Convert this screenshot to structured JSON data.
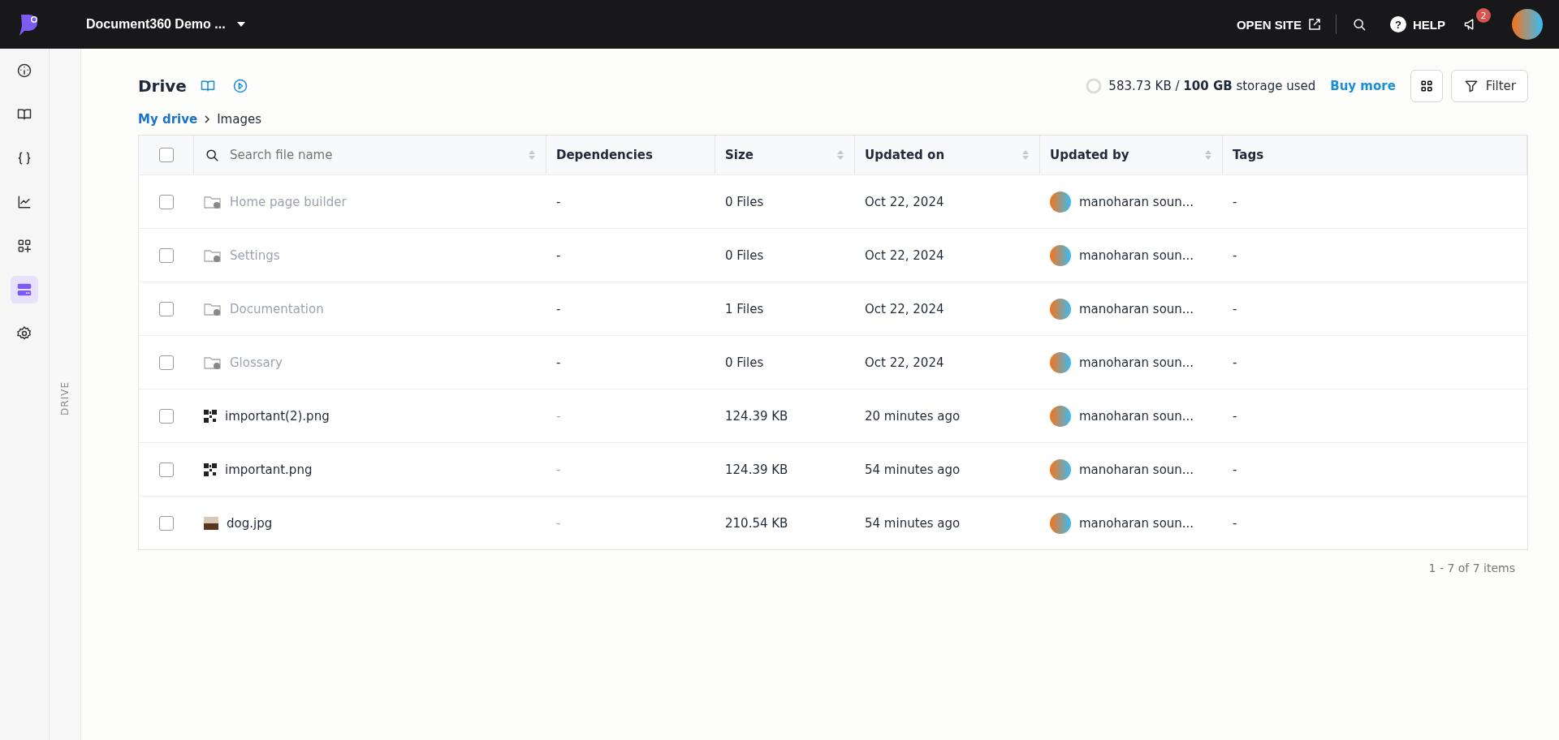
{
  "topbar": {
    "project": "Document360 Demo ...",
    "open_site": "OPEN SITE",
    "help_icon": "?",
    "help": "HELP",
    "notifications": "2"
  },
  "sidebar": {
    "items": [
      {
        "selected": false
      },
      {
        "selected": false
      },
      {
        "selected": false
      },
      {
        "selected": false
      },
      {
        "selected": false
      },
      {
        "selected": true
      },
      {
        "selected": false
      }
    ],
    "panel_label": "DRIVE"
  },
  "header": {
    "title": "Drive",
    "storage_used": "583.73 KB / **100 GB** storage used",
    "buy_more": "Buy more",
    "filter": "Filter"
  },
  "breadcrumb": [
    "My drive",
    "Images"
  ],
  "table": {
    "select_all_checked": false,
    "search_placeholder": "Search file name",
    "columns": [
      "Dependencies",
      "Size",
      "Updated on",
      "Updated by",
      "Tags"
    ],
    "rows": [
      {
        "kind": "folder",
        "checked": false,
        "name": "Home page builder",
        "dependencies": "-",
        "size": "0 Files",
        "updated_on": "Oct 22, 2024",
        "updated_by": "manoharan soun...",
        "tags": "-"
      },
      {
        "kind": "folder",
        "checked": false,
        "name": "Settings",
        "dependencies": "-",
        "size": "0 Files",
        "updated_on": "Oct 22, 2024",
        "updated_by": "manoharan soun...",
        "tags": "-"
      },
      {
        "kind": "folder",
        "checked": false,
        "name": "Documentation",
        "dependencies": "-",
        "size": "1 Files",
        "updated_on": "Oct 22, 2024",
        "updated_by": "manoharan soun...",
        "tags": "-"
      },
      {
        "kind": "folder",
        "checked": false,
        "name": "Glossary",
        "dependencies": "-",
        "size": "0 Files",
        "updated_on": "Oct 22, 2024",
        "updated_by": "manoharan soun...",
        "tags": "-"
      },
      {
        "kind": "qr",
        "checked": false,
        "name": "important(2).png",
        "dependencies": "-",
        "size": "124.39 KB",
        "updated_on": "20 minutes ago",
        "updated_by": "manoharan soun...",
        "tags": "-"
      },
      {
        "kind": "qr",
        "checked": false,
        "name": "important.png",
        "dependencies": "-",
        "size": "124.39 KB",
        "updated_on": "54 minutes ago",
        "updated_by": "manoharan soun...",
        "tags": "-"
      },
      {
        "kind": "photo",
        "checked": false,
        "name": "dog.jpg",
        "dependencies": "-",
        "size": "210.54 KB",
        "updated_on": "54 minutes ago",
        "updated_by": "manoharan soun...",
        "tags": "-"
      }
    ],
    "pagination": "1 - 7 of 7 items"
  }
}
